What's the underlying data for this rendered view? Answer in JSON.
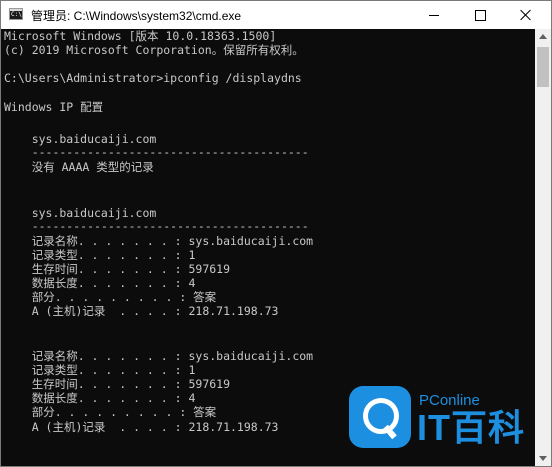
{
  "window": {
    "title": "管理员: C:\\Windows\\system32\\cmd.exe"
  },
  "console": {
    "lines": [
      "Microsoft Windows [版本 10.0.18363.1500]",
      "(c) 2019 Microsoft Corporation。保留所有权利。",
      "",
      "C:\\Users\\Administrator>ipconfig /displaydns",
      "",
      "Windows IP 配置",
      "",
      "    sys.baiducaiji.com",
      "    ----------------------------------------",
      "    没有 AAAA 类型的记录",
      "",
      "",
      "    sys.baiducaiji.com",
      "    ----------------------------------------",
      "    记录名称. . . . . . . : sys.baiducaiji.com",
      "    记录类型. . . . . . . : 1",
      "    生存时间. . . . . . . : 597619",
      "    数据长度. . . . . . . : 4",
      "    部分. . . . . . . . . : 答案",
      "    A (主机)记录  . . . . : 218.71.198.73",
      "",
      "",
      "    记录名称. . . . . . . : sys.baiducaiji.com",
      "    记录类型. . . . . . . : 1",
      "    生存时间. . . . . . . : 597619",
      "    数据长度. . . . . . . : 4",
      "    部分. . . . . . . . . : 答案",
      "    A (主机)记录  . . . . : 218.71.198.73"
    ]
  },
  "watermark": {
    "brand_small": "PConline",
    "brand_big": "IT百科",
    "color": "#1d8fe1"
  },
  "colors": {
    "console_bg": "#0c0c0c",
    "console_text": "#c8c8c8",
    "titlebar_bg": "#ffffff"
  }
}
